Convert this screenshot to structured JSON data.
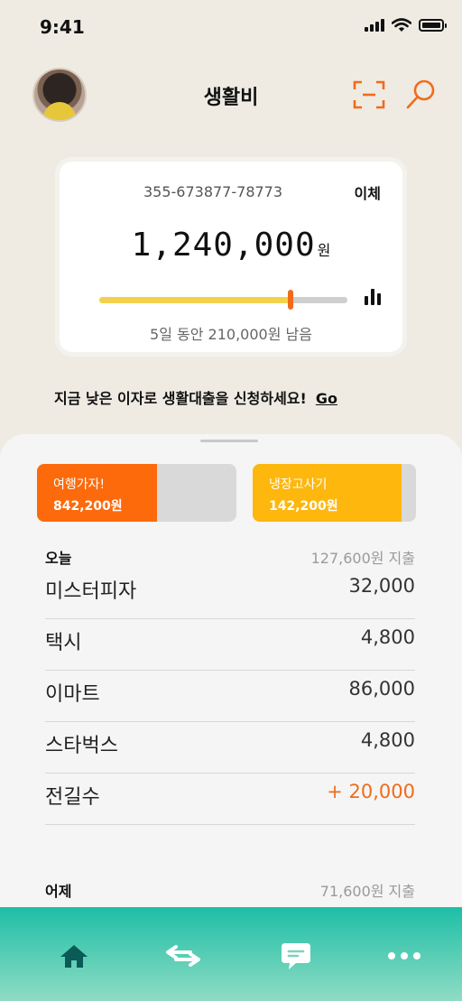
{
  "status": {
    "time": "9:41"
  },
  "header": {
    "title": "생활비"
  },
  "account": {
    "number": "355-673877-78773",
    "transfer_label": "이체",
    "balance": "1,240,000",
    "unit": "원",
    "progress": 0.77,
    "marker": 0.77,
    "remain_text": "5일 동안 210,000원 남음"
  },
  "promo": {
    "text": "지금 낮은 이자로 생활대출을 신청하세요!",
    "link": "Go"
  },
  "goals": [
    {
      "name": "여행가자!",
      "amount": "842,200원",
      "color": "#fd6a0c",
      "progress": 0.6
    },
    {
      "name": "냉장고사기",
      "amount": "142,200원",
      "color": "#fdb70d",
      "progress": 0.91
    }
  ],
  "today": {
    "label": "오늘",
    "total": "127,600원 지출",
    "transactions": [
      {
        "name": "미스터피자",
        "amount": "32,000"
      },
      {
        "name": "택시",
        "amount": "4,800"
      },
      {
        "name": "이마트",
        "amount": "86,000"
      },
      {
        "name": "스타벅스",
        "amount": "4,800"
      },
      {
        "name": "전길수",
        "amount": "+ 20,000"
      }
    ]
  },
  "yesterday": {
    "label": "어제",
    "total": "71,600원 지출"
  },
  "tabbar": {
    "icons": [
      "home-icon",
      "transfer-icon",
      "chat-icon",
      "more-icon"
    ]
  },
  "colors": {
    "accent": "#f06c1a",
    "progress": "#f2d24d",
    "tabbar_top": "#1ebea7",
    "tabbar_icon": "#0a5a57"
  }
}
